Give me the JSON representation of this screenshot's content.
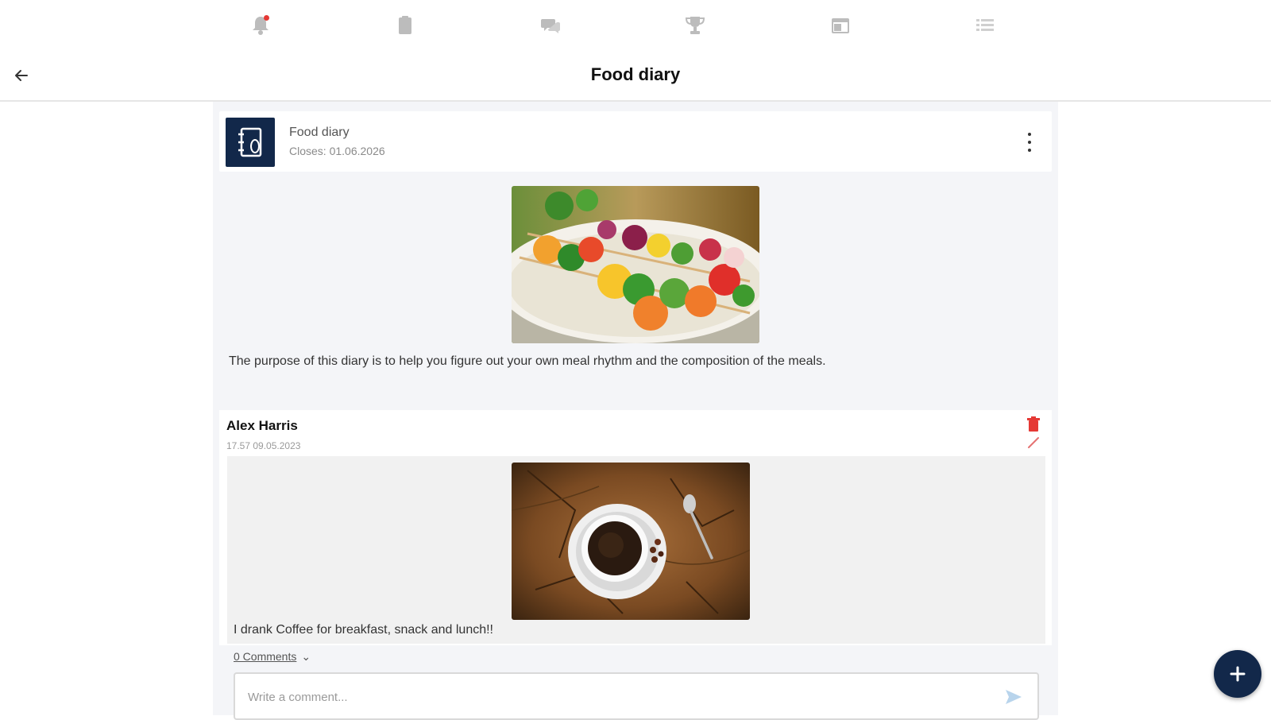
{
  "nav": {
    "icons": [
      "bell-icon",
      "document-icon",
      "chat-icon",
      "trophy-icon",
      "calendar-icon",
      "list-icon"
    ],
    "has_notification": true
  },
  "header": {
    "title": "Food diary",
    "back_icon": "arrow-left-icon"
  },
  "diary": {
    "title": "Food diary",
    "closes": "Closes: 01.06.2026",
    "description": "The purpose of this diary is to help you figure out your own meal rhythm and the composition of the meals."
  },
  "entry": {
    "author": "Alex Harris",
    "timestamp": "17.57 09.05.2023",
    "text": "I drank Coffee for breakfast, snack and lunch!!"
  },
  "comments": {
    "toggle_label": "0 Comments",
    "placeholder": "Write a comment..."
  },
  "colors": {
    "brand": "#12284a",
    "delete": "#e53935",
    "background": "#f4f5f8"
  }
}
